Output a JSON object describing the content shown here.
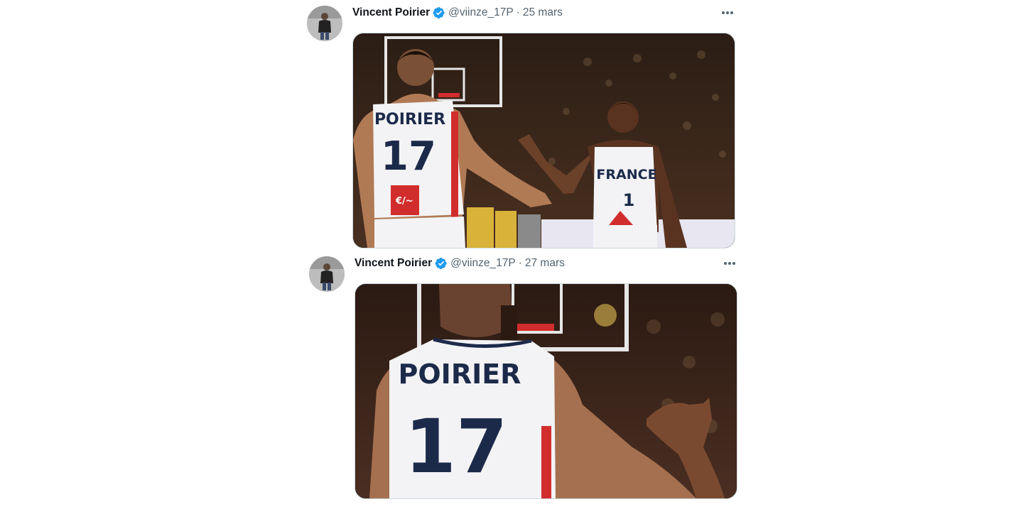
{
  "tweets": [
    {
      "author_name": "Vincent Poirier",
      "handle": "@viinze_17P",
      "separator": "·",
      "date": "25 mars",
      "verified": true,
      "avatar_icon": "profile-photo",
      "more_icon": "more-horizontal-icon",
      "photo": {
        "jersey_name": "POIRIER",
        "jersey_number": "17",
        "teammate_jersey_text": "FRANCE",
        "teammate_number": "1"
      }
    },
    {
      "author_name": "Vincent Poirier",
      "handle": "@viinze_17P",
      "separator": "·",
      "date": "27 mars",
      "verified": true,
      "avatar_icon": "profile-photo",
      "more_icon": "more-horizontal-icon",
      "photo": {
        "jersey_name": "POIRIER",
        "jersey_number": "17"
      }
    }
  ],
  "colors": {
    "verified_blue": "#1d9bf0",
    "text_primary": "#0f1419",
    "text_secondary": "#536471",
    "jersey_navy": "#1c2a4a",
    "jersey_red": "#d22d2d"
  }
}
